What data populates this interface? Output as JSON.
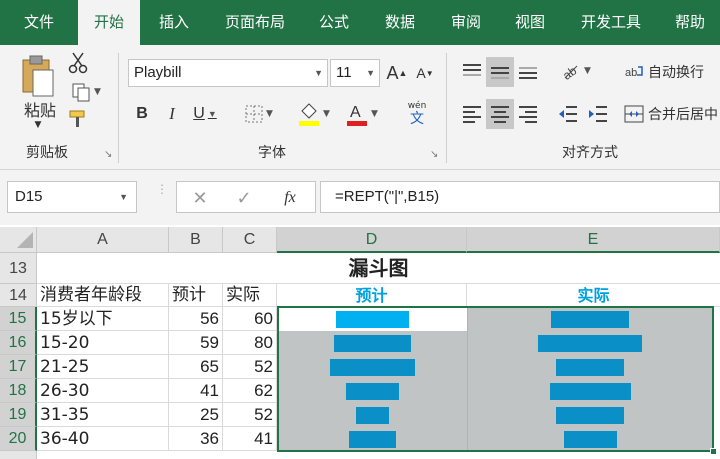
{
  "ribbon_tabs": [
    "文件",
    "开始",
    "插入",
    "页面布局",
    "公式",
    "数据",
    "审阅",
    "视图",
    "开发工具",
    "帮助"
  ],
  "active_tab": "开始",
  "clipboard": {
    "paste_label": "粘贴",
    "group_label": "剪贴板"
  },
  "font": {
    "name": "Playbill",
    "size": "11",
    "group_label": "字体",
    "bold": "B",
    "italic": "I",
    "underline": "U",
    "wen_top": "wén",
    "wen_bottom": "文"
  },
  "alignment": {
    "wrap_label": "自动换行",
    "merge_label": "合并后居中",
    "group_label": "对齐方式"
  },
  "formula_bar": {
    "name_box": "D15",
    "formula": "=REPT(\"|\",B15)",
    "fx": "fx"
  },
  "columns": [
    "A",
    "B",
    "C",
    "D",
    "E"
  ],
  "selected_columns": [
    "D",
    "E"
  ],
  "rows": [
    "13",
    "14",
    "15",
    "16",
    "17",
    "18",
    "19",
    "20"
  ],
  "selected_rows": [
    "15",
    "16",
    "17",
    "18",
    "19",
    "20"
  ],
  "sheet": {
    "title": "漏斗图",
    "headers": {
      "segment": "消费者年龄段",
      "planned": "预计",
      "actual": "实际",
      "d_header": "预计",
      "e_header": "实际"
    },
    "data": [
      {
        "segment": "15岁以下",
        "planned": "56",
        "actual": "60"
      },
      {
        "segment": "15-20",
        "planned": "59",
        "actual": "80"
      },
      {
        "segment": "21-25",
        "planned": "65",
        "actual": "52"
      },
      {
        "segment": "26-30",
        "planned": "41",
        "actual": "62"
      },
      {
        "segment": "31-35",
        "planned": "25",
        "actual": "52"
      },
      {
        "segment": "36-40",
        "planned": "36",
        "actual": "41"
      }
    ]
  },
  "colors": {
    "ribbon_green": "#217346",
    "bar_blue": "#0a8fc7",
    "bar_highlight": "#00b0f0",
    "header_cyan": "#00a0e0",
    "selection_gray": "#c0c4c4"
  },
  "icons": [
    "paste-icon",
    "cut-icon",
    "copy-icon",
    "format-painter-icon",
    "grow-font-icon",
    "shrink-font-icon",
    "border-icon",
    "fill-color-icon",
    "font-color-icon",
    "phonetic-icon",
    "align-top-icon",
    "align-middle-icon",
    "align-bottom-icon",
    "orientation-icon",
    "wrap-text-icon",
    "align-left-icon",
    "align-center-icon",
    "align-right-icon",
    "decrease-indent-icon",
    "increase-indent-icon",
    "merge-center-icon",
    "cancel-icon",
    "enter-icon",
    "function-icon"
  ]
}
